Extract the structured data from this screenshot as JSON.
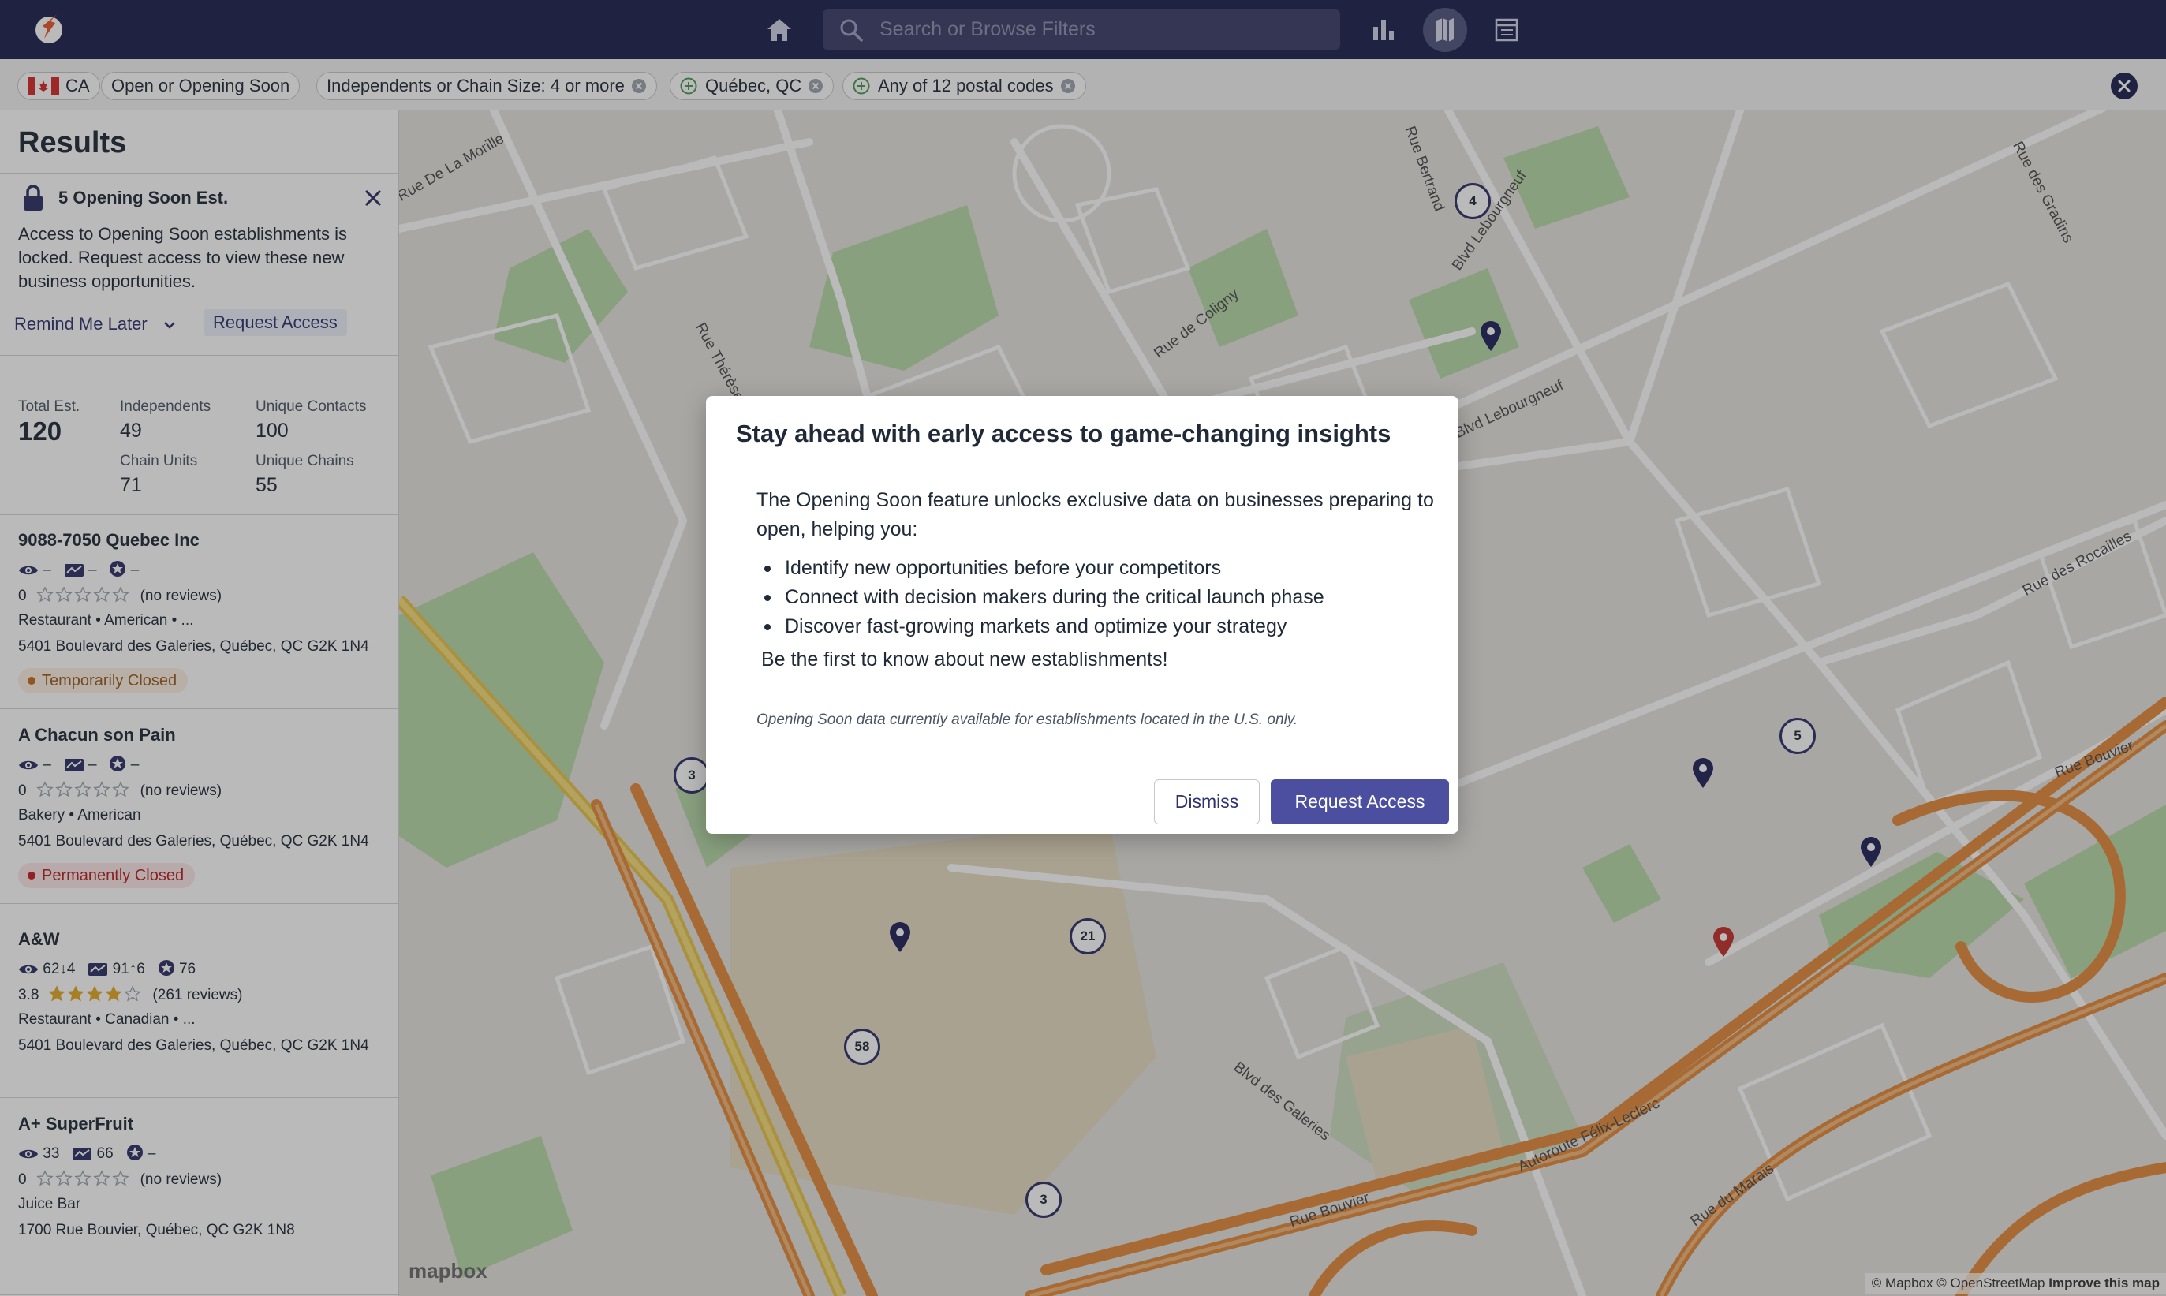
{
  "search": {
    "placeholder": "Search or Browse Filters"
  },
  "filters": {
    "country": "CA",
    "status": "Open or Opening Soon",
    "size": "Independents or Chain Size: 4 or more",
    "location": "Québec, QC",
    "postal": "Any of 12 postal codes"
  },
  "sidebar": {
    "title": "Results",
    "notice": {
      "title": "5 Opening Soon Est.",
      "text": "Access to Opening Soon establishments is locked. Request access to view these new business opportunities.",
      "remind_label": "Remind Me Later",
      "request_label": "Request Access"
    },
    "stats": {
      "total_label": "Total Est.",
      "total_value": "120",
      "independents_label": "Independents",
      "independents_value": "49",
      "chain_units_label": "Chain Units",
      "chain_units_value": "71",
      "unique_contacts_label": "Unique Contacts",
      "unique_contacts_value": "100",
      "unique_chains_label": "Unique Chains",
      "unique_chains_value": "55"
    },
    "results": [
      {
        "name": "9088-7050 Quebec Inc",
        "m1": "–",
        "m2": "–",
        "m3": "–",
        "rating": "0",
        "stars": 0,
        "reviews": "(no reviews)",
        "category": "Restaurant • American • ...",
        "address": "5401 Boulevard des Galeries, Québec, QC G2K 1N4",
        "status": "Temporarily Closed"
      },
      {
        "name": "A Chacun son Pain",
        "m1": "–",
        "m2": "–",
        "m3": "–",
        "rating": "0",
        "stars": 0,
        "reviews": "(no reviews)",
        "category": "Bakery • American",
        "address": "5401 Boulevard des Galeries, Québec, QC G2K 1N4",
        "status": "Permanently Closed"
      },
      {
        "name": "A&W",
        "m1": "62↓4",
        "m2": "91↑6",
        "m3": "76",
        "rating": "3.8",
        "stars": 4,
        "reviews": "(261 reviews)",
        "category": "Restaurant • Canadian • ...",
        "address": "5401 Boulevard des Galeries, Québec, QC G2K 1N4"
      },
      {
        "name": "A+ SuperFruit",
        "m1": "33",
        "m2": "66",
        "m3": "–",
        "rating": "0",
        "stars": 0,
        "reviews": "(no reviews)",
        "category": "Juice Bar",
        "address": "1700 Rue Bouvier, Québec, QC G2K 1N8"
      }
    ]
  },
  "map": {
    "labels": {
      "r1": "Rue De La Morille",
      "r2": "Rue Thérèse-Casgrain",
      "r3": "Rue de Coligny",
      "r4": "Blvd Lebourgneuf",
      "r5": "Blvd Lebourgneuf",
      "r6": "Rue des Rocailles",
      "r7": "Rue Bouvier",
      "r8": "Blvd des Galeries",
      "r9": "Autoroute Félix-Leclerc",
      "r10": "Rue du Marais",
      "r11": "Rue Bouvier",
      "r12": "Rue des Gradins",
      "r13": "Rue Bertrand"
    },
    "clusters": {
      "c1": "4",
      "c2": "5",
      "c3": "3",
      "c4": "21",
      "c5": "58",
      "c6": "3"
    },
    "logo": "mapbox",
    "attribution": "© Mapbox © OpenStreetMap",
    "improve": "Improve this map"
  },
  "modal": {
    "title": "Stay ahead with early access to game-changing insights",
    "intro": "The Opening Soon feature unlocks exclusive data on businesses preparing to open, helping you:",
    "bullets": [
      "Identify new opportunities before your competitors",
      "Connect with decision makers during the critical launch phase",
      "Discover fast-growing markets and optimize your strategy"
    ],
    "cta": "Be the first to know about new establishments!",
    "note": "Opening Soon data currently available for establishments located in the U.S. only.",
    "dismiss": "Dismiss",
    "request": "Request Access"
  },
  "colors": {
    "nav": "#1c1f4f",
    "accent": "#4c4f9f",
    "pin": "#1e2157",
    "pin_alert": "#c2302b"
  }
}
